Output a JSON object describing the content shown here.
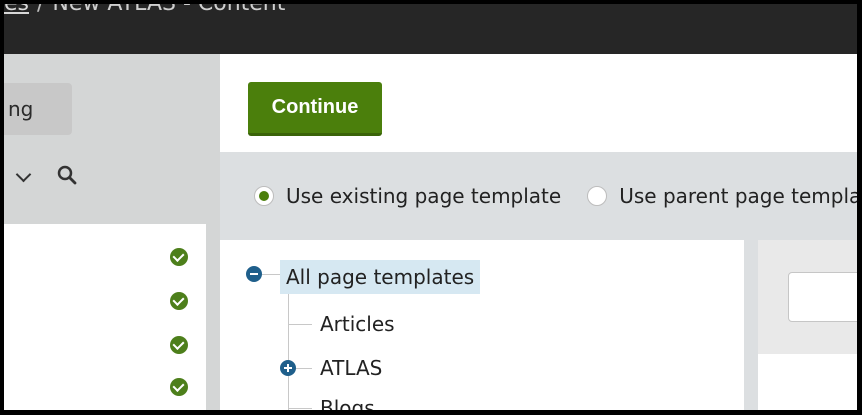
{
  "breadcrumb": {
    "link_label": "es",
    "separator": "/",
    "current": "New ATLAS - Content"
  },
  "left_panel": {
    "button_label": "ng",
    "status_items": [
      {
        "status": "ok",
        "color": "#4d7f1b"
      },
      {
        "status": "ok",
        "color": "#4d7f1b"
      },
      {
        "status": "ok",
        "color": "#4d7f1b"
      },
      {
        "status": "ok",
        "color": "#4d7f1b"
      }
    ]
  },
  "toolbar": {
    "continue_label": "Continue"
  },
  "template_options": {
    "option_existing": "Use existing page template",
    "option_parent": "Use parent page template",
    "selected": "option_existing"
  },
  "tree": {
    "root_label": "All page templates",
    "items": [
      "Articles",
      "ATLAS",
      "Blogs"
    ]
  },
  "colors": {
    "accent_green": "#4b7f0c",
    "tree_blue": "#1f5f8b",
    "selection_bg": "#d6e8f2"
  }
}
